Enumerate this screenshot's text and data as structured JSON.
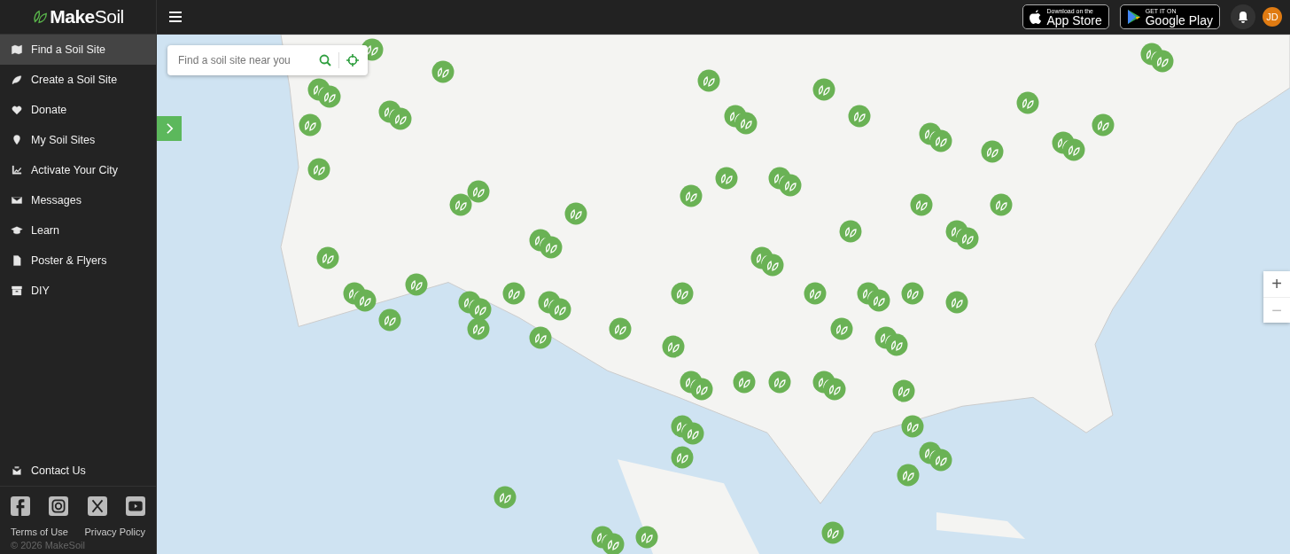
{
  "brand": {
    "name_bold": "Make",
    "name_light": "Soil"
  },
  "topbar": {
    "app_store": {
      "small": "Download on the",
      "big": "App Store"
    },
    "google_play": {
      "small": "GET IT ON",
      "big": "Google Play"
    },
    "avatar": "JD"
  },
  "sidebar": {
    "items": [
      {
        "label": "Find a Soil Site",
        "selected": true
      },
      {
        "label": "Create a Soil Site",
        "selected": false
      },
      {
        "label": "Donate",
        "selected": false
      },
      {
        "label": "My Soil Sites",
        "selected": false
      },
      {
        "label": "Activate Your City",
        "selected": false
      },
      {
        "label": "Messages",
        "selected": false
      },
      {
        "label": "Learn",
        "selected": false
      },
      {
        "label": "Poster & Flyers",
        "selected": false
      },
      {
        "label": "DIY",
        "selected": false
      }
    ],
    "contact": "Contact Us",
    "links": [
      "Terms of Use",
      "Privacy Policy"
    ],
    "copyright": "© 2026 MakeSoil"
  },
  "map": {
    "search": {
      "placeholder": "Find a soil site near you"
    },
    "zoom_in": "+",
    "zoom_out": "−"
  }
}
